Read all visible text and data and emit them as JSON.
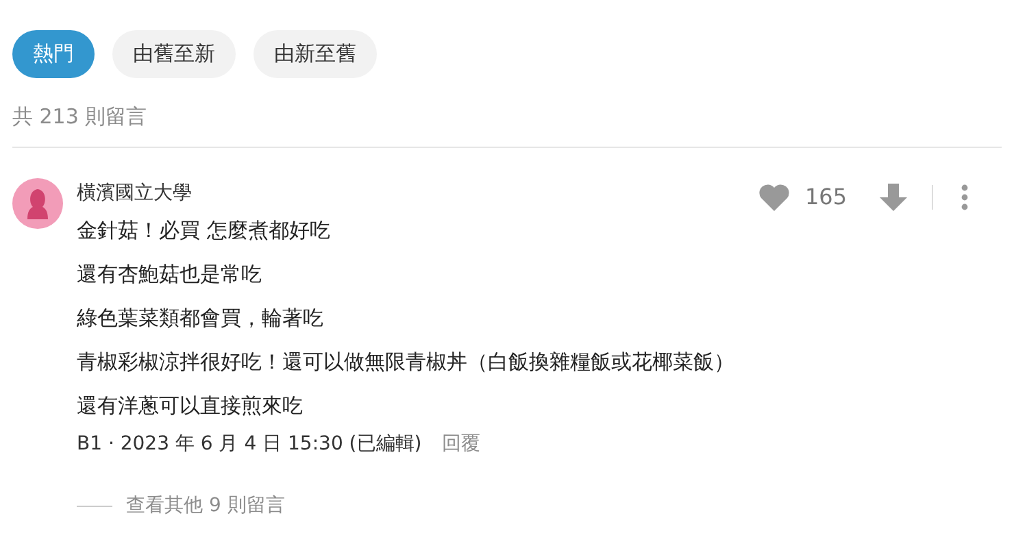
{
  "sort_tabs": [
    {
      "label": "熱門",
      "selected": true
    },
    {
      "label": "由舊至新",
      "selected": false
    },
    {
      "label": "由新至舊",
      "selected": false
    }
  ],
  "comment_count": "共 213 則留言",
  "comment": {
    "author": "橫濱國立大學",
    "likes": "165",
    "lines": [
      "金針菇！必買 怎麼煮都好吃",
      "還有杏鮑菇也是常吃",
      "綠色葉菜類都會買，輪著吃",
      "青椒彩椒涼拌很好吃！還可以做無限青椒丼（白飯換雜糧飯或花椰菜飯）",
      "還有洋蔥可以直接煎來吃"
    ],
    "meta": "B1 · 2023 年 6 月 4 日 15:30 (已編輯)",
    "reply": "回覆"
  },
  "more_replies": "查看其他 9 則留言"
}
